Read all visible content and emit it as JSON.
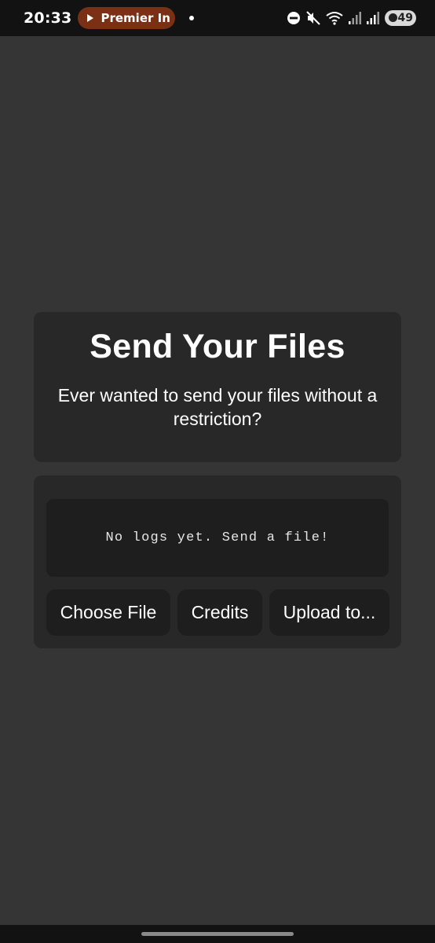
{
  "status_bar": {
    "time": "20:33",
    "media_title": "Premier In",
    "battery_level": "49",
    "icons": [
      "dnd-icon",
      "mute-icon",
      "wifi-icon",
      "signal-icon",
      "signal-icon",
      "battery-icon"
    ]
  },
  "hero": {
    "title": "Send Your Files",
    "subtitle": "Ever wanted to send your files without a restriction?"
  },
  "log": {
    "empty_text": "No logs yet. Send a file!"
  },
  "actions": {
    "choose_file": "Choose File",
    "credits": "Credits",
    "upload": "Upload to..."
  },
  "colors": {
    "background": "#353535",
    "card": "#282828",
    "inner": "#1e1e1e",
    "media_pill": "#7a3015"
  }
}
